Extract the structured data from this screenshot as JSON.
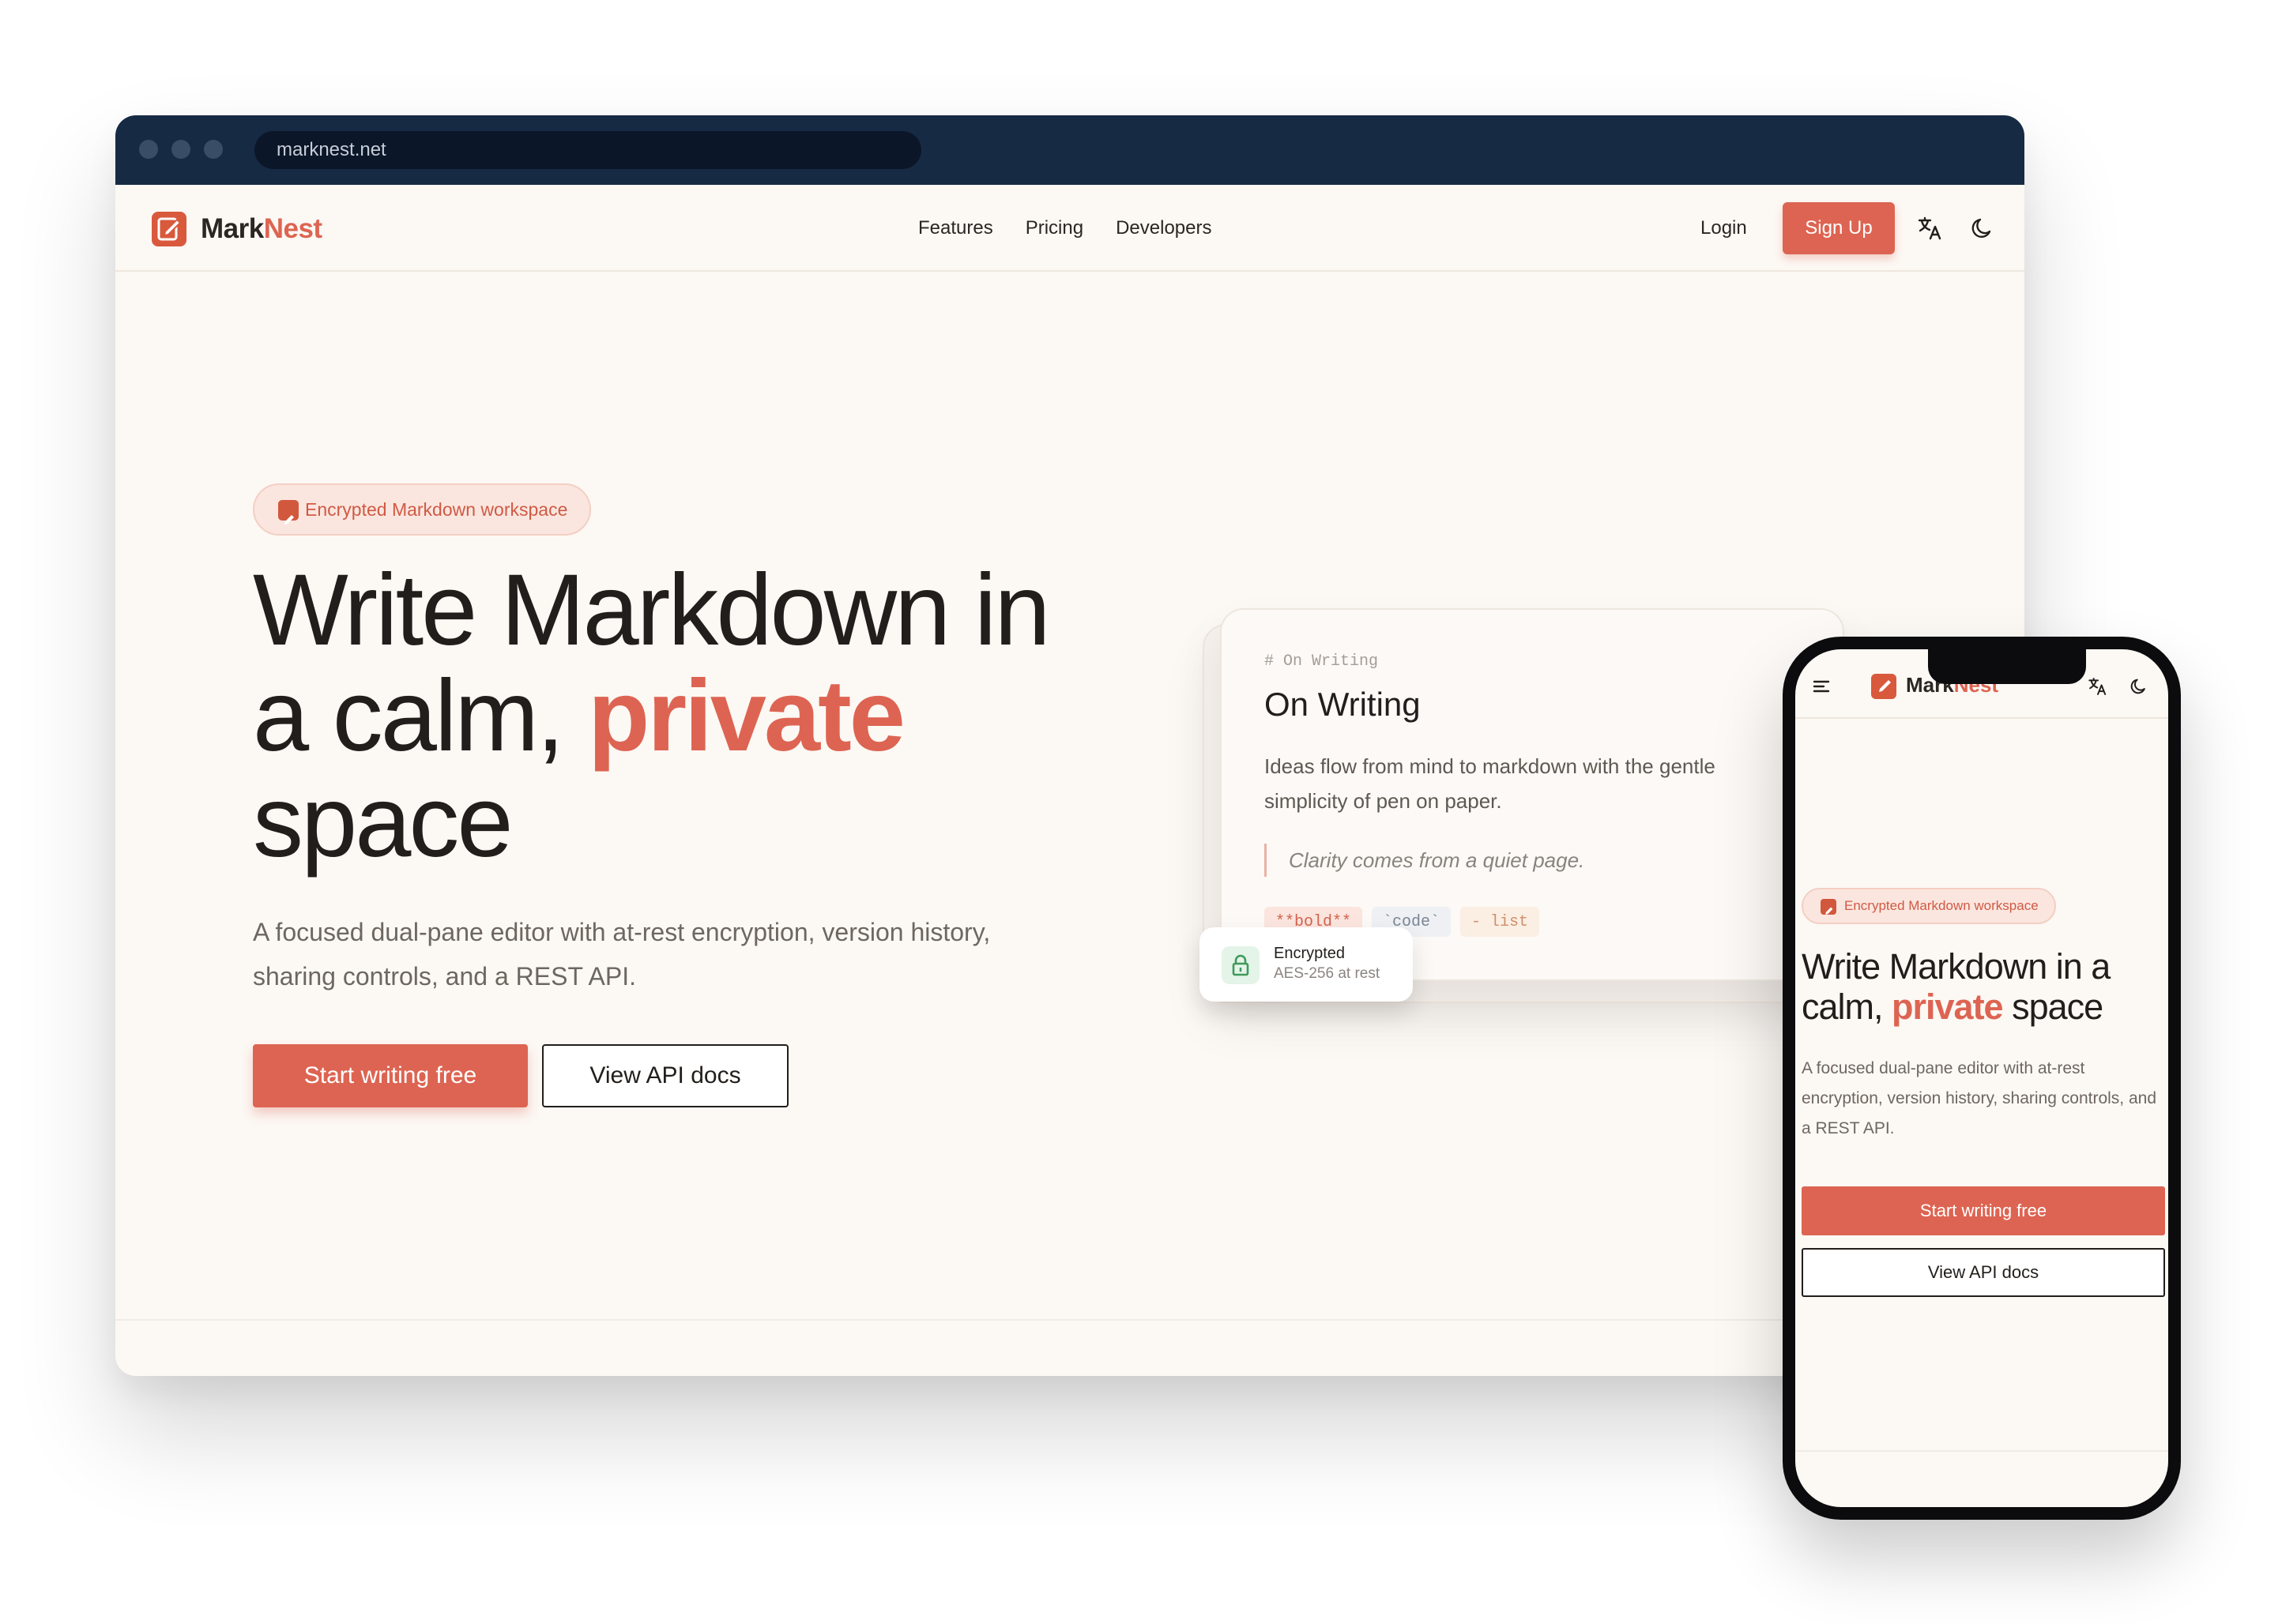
{
  "browser": {
    "url": "marknest.net"
  },
  "nav": {
    "logo_part1": "Mark",
    "logo_part2": "Nest",
    "links": [
      "Features",
      "Pricing",
      "Developers"
    ],
    "login": "Login",
    "signup": "Sign Up",
    "icons": [
      "translate-icon",
      "moon-icon"
    ]
  },
  "hero": {
    "badge": "Encrypted Markdown workspace",
    "headline_line1": "Write Markdown in",
    "headline_line2_prefix": "a calm, ",
    "headline_accent": "private",
    "headline_line3": "space",
    "subtitle": "A focused dual-pane editor with at-rest encryption, version history, sharing controls, and a REST API.",
    "cta_primary": "Start writing free",
    "cta_secondary": "View API docs"
  },
  "doc_card": {
    "markdown_heading": "# On Writing",
    "title": "On Writing",
    "body": "Ideas flow from mind to markdown with the gentle simplicity of pen on paper.",
    "quote": "Clarity comes from a quiet page.",
    "chips": [
      "**bold**",
      "`code`",
      "- list"
    ]
  },
  "encrypted_toast": {
    "title": "Encrypted",
    "subtitle": "AES-256 at rest"
  },
  "phone": {
    "logo_part1": "Mark",
    "logo_part2": "Nest",
    "badge": "Encrypted Markdown workspace",
    "headline_line1": "Write Markdown in a",
    "headline_line2_prefix": "calm, ",
    "headline_accent": "private",
    "headline_line2_suffix": " space",
    "subtitle": "A focused dual-pane editor with at-rest encryption, version history, sharing controls, and a REST API.",
    "cta_primary": "Start writing free",
    "cta_secondary": "View API docs"
  },
  "colors": {
    "accent": "#dd6452",
    "chrome": "#172a44",
    "page_bg": "#fcf8f4",
    "text": "#221e1b"
  }
}
